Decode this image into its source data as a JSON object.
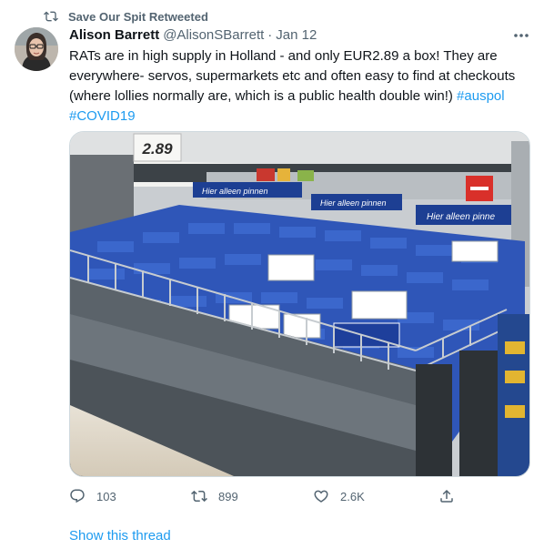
{
  "retweet": {
    "label": "Save Our Spit Retweeted"
  },
  "author": {
    "name": "Alison Barrett",
    "handle": "@AlisonSBarrett",
    "separator": "·",
    "date": "Jan 12"
  },
  "tweet": {
    "text": "RATs are in high supply in Holland - and only EUR2.89 a box! They are everywhere- servos, supermarkets etc and often easy to find at checkouts (where lollies normally are, which is a public health double win!) ",
    "hashtags": [
      "#auspol",
      "#COVID19"
    ]
  },
  "media": {
    "price_tag": "2.89",
    "shelf_labels": [
      "Hier alleen pinnen",
      "Hier alleen pinnen",
      "Hier alleen pinne"
    ]
  },
  "actions": {
    "replies": "103",
    "retweets": "899",
    "likes": "2.6K"
  },
  "links": {
    "show_thread": "Show this thread"
  },
  "colors": {
    "accent": "#1d9bf0",
    "muted": "#536471",
    "text": "#0f1419",
    "border": "#cfd9de"
  },
  "icons": [
    "retweet-icon",
    "more-icon",
    "reply-icon",
    "retweet-icon",
    "like-icon",
    "share-icon"
  ]
}
